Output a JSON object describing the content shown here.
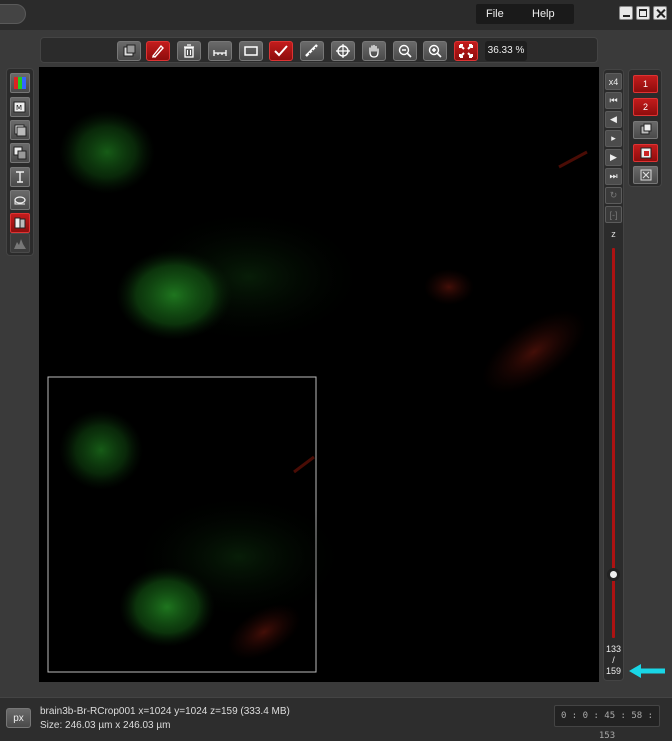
{
  "menu": {
    "file": "File",
    "help": "Help"
  },
  "toolbar": {
    "zoom": "36.33 %"
  },
  "zpanel": {
    "x4": "x4",
    "zoom_axis_label": "z",
    "current_slice": "133",
    "separator": "/",
    "total_slices": "159",
    "slider_level": 0.8365
  },
  "channels": {
    "ch1": "1",
    "ch2": "2"
  },
  "status": {
    "px_button": "px",
    "info_line": "brain3b-Br-RCrop001 x=1024 y=1024 z=159  (333.4 MB)",
    "size_line": "Size: 246.03 µm x 246.03 µm",
    "timer": "0 : 0 : 45 : 58 : 153"
  },
  "colors": {
    "accent_red": "#ad1212",
    "arrow": "#19d6e6",
    "green_signal": "#1e7a1e",
    "red_signal": "#7a1a0e"
  },
  "icons": {
    "toolbar": [
      "layers-icon",
      "pen-icon",
      "trash-icon",
      "measure-icon",
      "rectangle-icon",
      "check-icon",
      "ruler-icon",
      "crosshair-icon",
      "hand-icon",
      "zoom-out-icon",
      "zoom-in-icon",
      "fit-icon"
    ],
    "left": [
      "rgb-channels-icon",
      "max-projection-icon",
      "stack-icon",
      "slices-icon",
      "z-axis-icon",
      "rotate-icon",
      "compare-icon",
      "histogram-icon"
    ]
  }
}
